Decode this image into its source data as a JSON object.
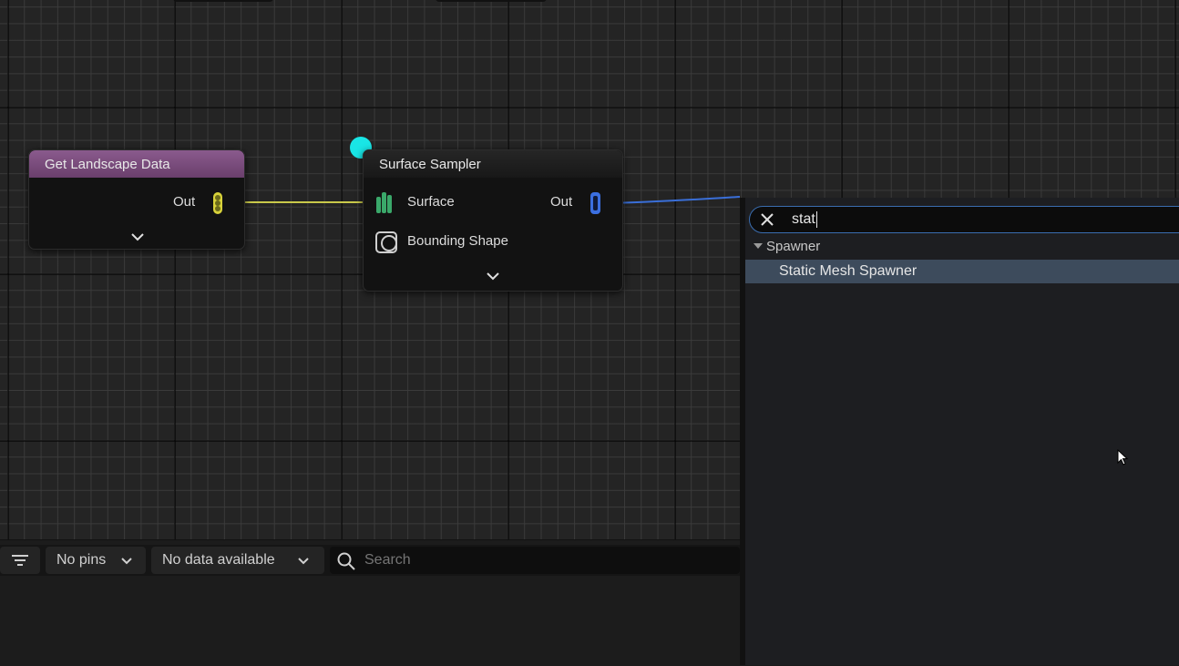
{
  "graph": {
    "nodes": {
      "get_landscape_data": {
        "title": "Get Landscape Data",
        "out_label": "Out",
        "header_color": "#7d4f80"
      },
      "surface_sampler": {
        "title": "Surface Sampler",
        "input_surface_label": "Surface",
        "input_bounding_label": "Bounding Shape",
        "out_label": "Out",
        "header_color": "#1c1c1c"
      }
    },
    "colors": {
      "wire_yellow": "#c9c94a",
      "wire_blue": "#3a6fd8",
      "pin_yellow": "#d8d23a",
      "pin_green": "#3aa86a",
      "pin_blue": "#3b6fe0",
      "reroute_cyan": "#19e6e6"
    }
  },
  "bottom_toolbar": {
    "pins_dropdown": "No pins",
    "data_dropdown": "No data available",
    "search_placeholder": "Search"
  },
  "context_menu": {
    "search_value": "stat",
    "category": "Spawner",
    "results": [
      "Static Mesh Spawner"
    ]
  }
}
